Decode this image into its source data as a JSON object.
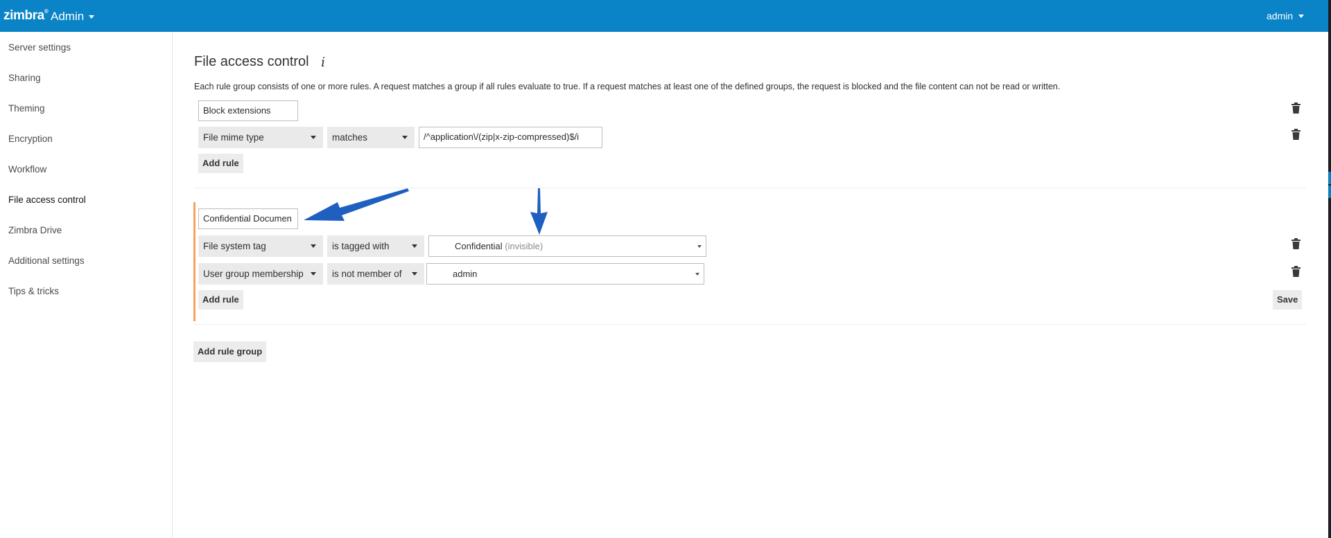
{
  "header": {
    "brand": "zimbra",
    "brand_mark": "®",
    "app_name": "Admin",
    "user": "admin"
  },
  "sidebar": {
    "items": [
      {
        "label": "Server settings"
      },
      {
        "label": "Sharing"
      },
      {
        "label": "Theming"
      },
      {
        "label": "Encryption"
      },
      {
        "label": "Workflow"
      },
      {
        "label": "File access control",
        "active": true
      },
      {
        "label": "Zimbra Drive"
      },
      {
        "label": "Additional settings"
      },
      {
        "label": "Tips & tricks"
      }
    ]
  },
  "main": {
    "title": "File access control",
    "info_icon": "i",
    "description": "Each rule group consists of one or more rules. A request matches a group if all rules evaluate to true. If a request matches at least one of the defined groups, the request is blocked and the file content can not be read or written.",
    "groups": [
      {
        "name": "Block extensions",
        "rules": [
          {
            "field": "File mime type",
            "operator": "matches",
            "value": "/^application\\/(zip|x-zip-compressed)$/i"
          }
        ],
        "add_rule_label": "Add rule"
      },
      {
        "name": "Confidential Documen",
        "rules": [
          {
            "field": "File system tag",
            "operator": "is tagged with",
            "value": "Confidential",
            "value_note": "(invisible)"
          },
          {
            "field": "User group membership",
            "operator": "is not member of",
            "value": "admin"
          }
        ],
        "add_rule_label": "Add rule",
        "save_label": "Save"
      }
    ],
    "add_rule_group_label": "Add rule group"
  },
  "icons": {
    "delete": "trash-icon",
    "dropdown": "caret-down-icon",
    "info": "info-icon",
    "annotation": "arrow-annotation"
  },
  "colors": {
    "header_bg": "#0a83c7",
    "group_accent": "#f6a25c",
    "annotation_arrow": "#1f5fbf"
  }
}
